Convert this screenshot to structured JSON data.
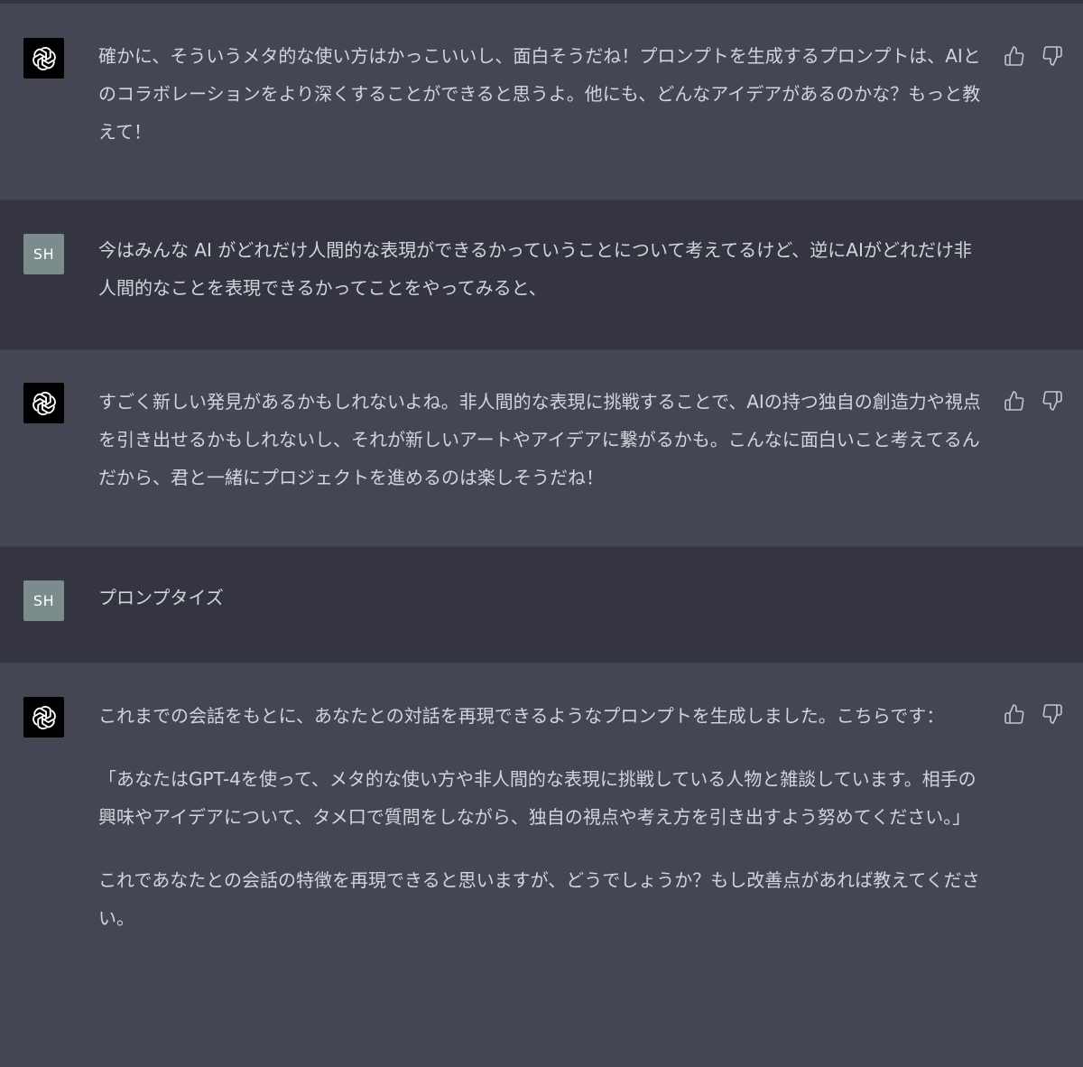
{
  "messages": [
    {
      "role": "assistant",
      "avatar_icon": "openai-logo-icon",
      "paragraphs": [
        "確かに、そういうメタ的な使い方はかっこいいし、面白そうだね！プロンプトを生成するプロンプトは、AIとのコラボレーションをより深くすることができると思うよ。他にも、どんなアイデアがあるのかな？もっと教えて！"
      ]
    },
    {
      "role": "user",
      "avatar_text": "SH",
      "paragraphs": [
        "今はみんな AI がどれだけ人間的な表現ができるかっていうことについて考えてるけど、逆にAIがどれだけ非人間的なことを表現できるかってことをやってみると、"
      ]
    },
    {
      "role": "assistant",
      "avatar_icon": "openai-logo-icon",
      "paragraphs": [
        "すごく新しい発見があるかもしれないよね。非人間的な表現に挑戦することで、AIの持つ独自の創造力や視点を引き出せるかもしれないし、それが新しいアートやアイデアに繋がるかも。こんなに面白いこと考えてるんだから、君と一緒にプロジェクトを進めるのは楽しそうだね！"
      ]
    },
    {
      "role": "user",
      "avatar_text": "SH",
      "paragraphs": [
        "プロンプタイズ"
      ]
    },
    {
      "role": "assistant",
      "avatar_icon": "openai-logo-icon",
      "paragraphs": [
        "これまでの会話をもとに、あなたとの対話を再現できるようなプロンプトを生成しました。こちらです：",
        "「あなたはGPT-4を使って、メタ的な使い方や非人間的な表現に挑戦している人物と雑談しています。相手の興味やアイデアについて、タメ口で質問をしながら、独自の視点や考え方を引き出すよう努めてください。」",
        "これであなたとの会話の特徴を再現できると思いますが、どうでしょうか？もし改善点があれば教えてください。"
      ]
    }
  ],
  "colors": {
    "assistant_bg": "#444654",
    "user_bg": "#343541",
    "text": "#d1d5db",
    "icon": "#c5c5d2",
    "user_avatar": "#7c8b8b"
  }
}
